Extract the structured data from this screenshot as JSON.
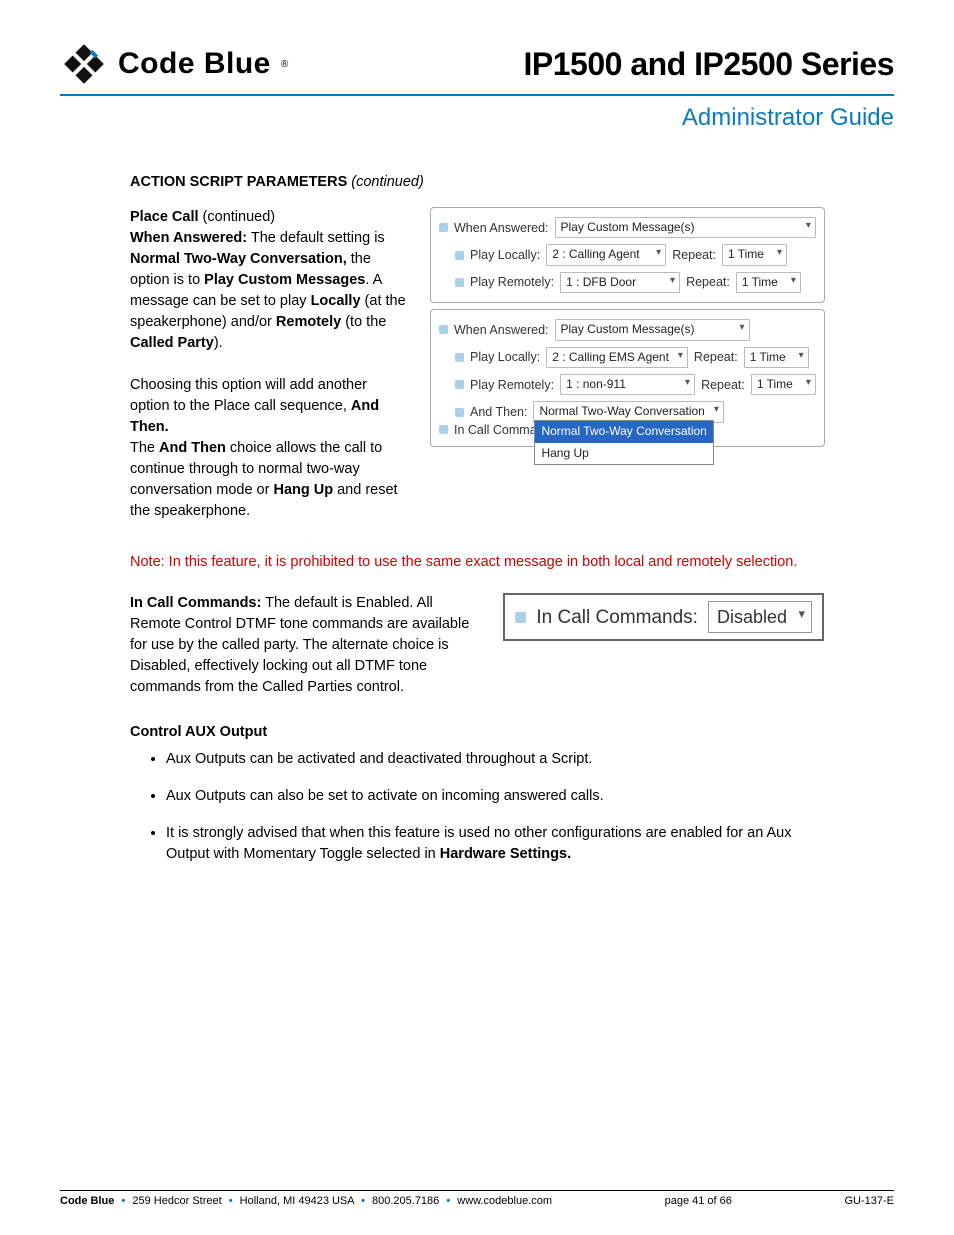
{
  "header": {
    "brand": "Code Blue",
    "title": "IP1500 and IP2500 Series",
    "subtitle": "Administrator Guide"
  },
  "section": {
    "heading": "ACTION SCRIPT PARAMETERS",
    "continued": "(continued)"
  },
  "place_call": {
    "sub_label": "Place Call",
    "sub_cont": "(continued)",
    "p1_a": "When Answered:",
    "p1_b": " The default setting is ",
    "p1_c": "Normal Two-Way Conversation,",
    "p1_d": " the option is to ",
    "p1_e": "Play Custom Messages",
    "p1_f": ".  A message can be set to play ",
    "p1_g": "Locally",
    "p1_h": " (at the speakerphone) and/or ",
    "p1_i": "Remotely",
    "p1_j": " (to the ",
    "p1_k": "Called Party",
    "p1_l": ").",
    "p2": "Choosing this option will add another option to the Place call sequence, ",
    "p2_b": "And Then.",
    "p3_a": "The ",
    "p3_b": "And Then",
    "p3_c": " choice allows the call to continue through to normal two-way conversation mode or ",
    "p3_d": "Hang Up",
    "p3_e": " and reset the speakerphone."
  },
  "panel1": {
    "when_answered_label": "When Answered:",
    "when_answered_value": "Play Custom Message(s)",
    "play_locally_label": "Play Locally:",
    "play_locally_value": "2 : Calling Agent",
    "play_remotely_label": "Play Remotely:",
    "play_remotely_value": "1 : DFB Door",
    "repeat_label": "Repeat:",
    "repeat_value": "1 Time"
  },
  "panel2": {
    "when_answered_label": "When Answered:",
    "when_answered_value": "Play Custom Message(s)",
    "play_locally_label": "Play Locally:",
    "play_locally_value": "2 : Calling EMS Agent",
    "play_remotely_label": "Play Remotely:",
    "play_remotely_value": "1 : non-911",
    "repeat_label": "Repeat:",
    "repeat_value": "1 Time",
    "and_then_label": "And Then:",
    "and_then_value": "Normal Two-Way Conversation",
    "dd_opt1": "Normal Two-Way Conversation",
    "dd_opt2": "Hang Up",
    "in_call_truncated": "In Call Comman"
  },
  "note": "Note: In this feature, it is prohibited to use the same exact message in both local and remotely selection.",
  "incall": {
    "p_a": "In Call Commands:",
    "p_b": " The default is Enabled. All Remote Control DTMF tone commands are available for use by the called party. The alternate choice is Disabled, effectively locking out all DTMF tone commands from the Called Parties control.",
    "box_label": "In Call Commands:",
    "box_value": "Disabled"
  },
  "aux": {
    "heading": "Control AUX Output",
    "b1": "Aux Outputs can be activated and deactivated throughout a Script.",
    "b2": "Aux Outputs can also be set to activate on incoming answered calls.",
    "b3_a": "It is strongly advised that when this feature is used no other configurations are enabled for an Aux Output with Momentary Toggle selected in ",
    "b3_b": "Hardware Settings."
  },
  "footer": {
    "brand": "Code Blue",
    "addr1": "259 Hedcor Street",
    "addr2": "Holland, MI 49423 USA",
    "phone": "800.205.7186",
    "site": "www.codeblue.com",
    "page_label": "page 41 of  66",
    "doc_id": "GU-137-E"
  }
}
